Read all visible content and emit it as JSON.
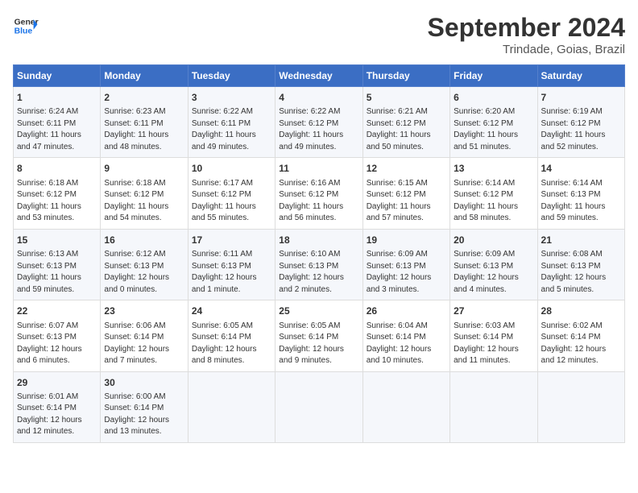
{
  "header": {
    "logo_line1": "General",
    "logo_line2": "Blue",
    "title": "September 2024",
    "subtitle": "Trindade, Goias, Brazil"
  },
  "weekdays": [
    "Sunday",
    "Monday",
    "Tuesday",
    "Wednesday",
    "Thursday",
    "Friday",
    "Saturday"
  ],
  "weeks": [
    [
      {
        "day": "1",
        "lines": [
          "Sunrise: 6:24 AM",
          "Sunset: 6:11 PM",
          "Daylight: 11 hours",
          "and 47 minutes."
        ]
      },
      {
        "day": "2",
        "lines": [
          "Sunrise: 6:23 AM",
          "Sunset: 6:11 PM",
          "Daylight: 11 hours",
          "and 48 minutes."
        ]
      },
      {
        "day": "3",
        "lines": [
          "Sunrise: 6:22 AM",
          "Sunset: 6:11 PM",
          "Daylight: 11 hours",
          "and 49 minutes."
        ]
      },
      {
        "day": "4",
        "lines": [
          "Sunrise: 6:22 AM",
          "Sunset: 6:12 PM",
          "Daylight: 11 hours",
          "and 49 minutes."
        ]
      },
      {
        "day": "5",
        "lines": [
          "Sunrise: 6:21 AM",
          "Sunset: 6:12 PM",
          "Daylight: 11 hours",
          "and 50 minutes."
        ]
      },
      {
        "day": "6",
        "lines": [
          "Sunrise: 6:20 AM",
          "Sunset: 6:12 PM",
          "Daylight: 11 hours",
          "and 51 minutes."
        ]
      },
      {
        "day": "7",
        "lines": [
          "Sunrise: 6:19 AM",
          "Sunset: 6:12 PM",
          "Daylight: 11 hours",
          "and 52 minutes."
        ]
      }
    ],
    [
      {
        "day": "8",
        "lines": [
          "Sunrise: 6:18 AM",
          "Sunset: 6:12 PM",
          "Daylight: 11 hours",
          "and 53 minutes."
        ]
      },
      {
        "day": "9",
        "lines": [
          "Sunrise: 6:18 AM",
          "Sunset: 6:12 PM",
          "Daylight: 11 hours",
          "and 54 minutes."
        ]
      },
      {
        "day": "10",
        "lines": [
          "Sunrise: 6:17 AM",
          "Sunset: 6:12 PM",
          "Daylight: 11 hours",
          "and 55 minutes."
        ]
      },
      {
        "day": "11",
        "lines": [
          "Sunrise: 6:16 AM",
          "Sunset: 6:12 PM",
          "Daylight: 11 hours",
          "and 56 minutes."
        ]
      },
      {
        "day": "12",
        "lines": [
          "Sunrise: 6:15 AM",
          "Sunset: 6:12 PM",
          "Daylight: 11 hours",
          "and 57 minutes."
        ]
      },
      {
        "day": "13",
        "lines": [
          "Sunrise: 6:14 AM",
          "Sunset: 6:12 PM",
          "Daylight: 11 hours",
          "and 58 minutes."
        ]
      },
      {
        "day": "14",
        "lines": [
          "Sunrise: 6:14 AM",
          "Sunset: 6:13 PM",
          "Daylight: 11 hours",
          "and 59 minutes."
        ]
      }
    ],
    [
      {
        "day": "15",
        "lines": [
          "Sunrise: 6:13 AM",
          "Sunset: 6:13 PM",
          "Daylight: 11 hours",
          "and 59 minutes."
        ]
      },
      {
        "day": "16",
        "lines": [
          "Sunrise: 6:12 AM",
          "Sunset: 6:13 PM",
          "Daylight: 12 hours",
          "and 0 minutes."
        ]
      },
      {
        "day": "17",
        "lines": [
          "Sunrise: 6:11 AM",
          "Sunset: 6:13 PM",
          "Daylight: 12 hours",
          "and 1 minute."
        ]
      },
      {
        "day": "18",
        "lines": [
          "Sunrise: 6:10 AM",
          "Sunset: 6:13 PM",
          "Daylight: 12 hours",
          "and 2 minutes."
        ]
      },
      {
        "day": "19",
        "lines": [
          "Sunrise: 6:09 AM",
          "Sunset: 6:13 PM",
          "Daylight: 12 hours",
          "and 3 minutes."
        ]
      },
      {
        "day": "20",
        "lines": [
          "Sunrise: 6:09 AM",
          "Sunset: 6:13 PM",
          "Daylight: 12 hours",
          "and 4 minutes."
        ]
      },
      {
        "day": "21",
        "lines": [
          "Sunrise: 6:08 AM",
          "Sunset: 6:13 PM",
          "Daylight: 12 hours",
          "and 5 minutes."
        ]
      }
    ],
    [
      {
        "day": "22",
        "lines": [
          "Sunrise: 6:07 AM",
          "Sunset: 6:13 PM",
          "Daylight: 12 hours",
          "and 6 minutes."
        ]
      },
      {
        "day": "23",
        "lines": [
          "Sunrise: 6:06 AM",
          "Sunset: 6:14 PM",
          "Daylight: 12 hours",
          "and 7 minutes."
        ]
      },
      {
        "day": "24",
        "lines": [
          "Sunrise: 6:05 AM",
          "Sunset: 6:14 PM",
          "Daylight: 12 hours",
          "and 8 minutes."
        ]
      },
      {
        "day": "25",
        "lines": [
          "Sunrise: 6:05 AM",
          "Sunset: 6:14 PM",
          "Daylight: 12 hours",
          "and 9 minutes."
        ]
      },
      {
        "day": "26",
        "lines": [
          "Sunrise: 6:04 AM",
          "Sunset: 6:14 PM",
          "Daylight: 12 hours",
          "and 10 minutes."
        ]
      },
      {
        "day": "27",
        "lines": [
          "Sunrise: 6:03 AM",
          "Sunset: 6:14 PM",
          "Daylight: 12 hours",
          "and 11 minutes."
        ]
      },
      {
        "day": "28",
        "lines": [
          "Sunrise: 6:02 AM",
          "Sunset: 6:14 PM",
          "Daylight: 12 hours",
          "and 12 minutes."
        ]
      }
    ],
    [
      {
        "day": "29",
        "lines": [
          "Sunrise: 6:01 AM",
          "Sunset: 6:14 PM",
          "Daylight: 12 hours",
          "and 12 minutes."
        ]
      },
      {
        "day": "30",
        "lines": [
          "Sunrise: 6:00 AM",
          "Sunset: 6:14 PM",
          "Daylight: 12 hours",
          "and 13 minutes."
        ]
      },
      {
        "day": "",
        "lines": []
      },
      {
        "day": "",
        "lines": []
      },
      {
        "day": "",
        "lines": []
      },
      {
        "day": "",
        "lines": []
      },
      {
        "day": "",
        "lines": []
      }
    ]
  ]
}
